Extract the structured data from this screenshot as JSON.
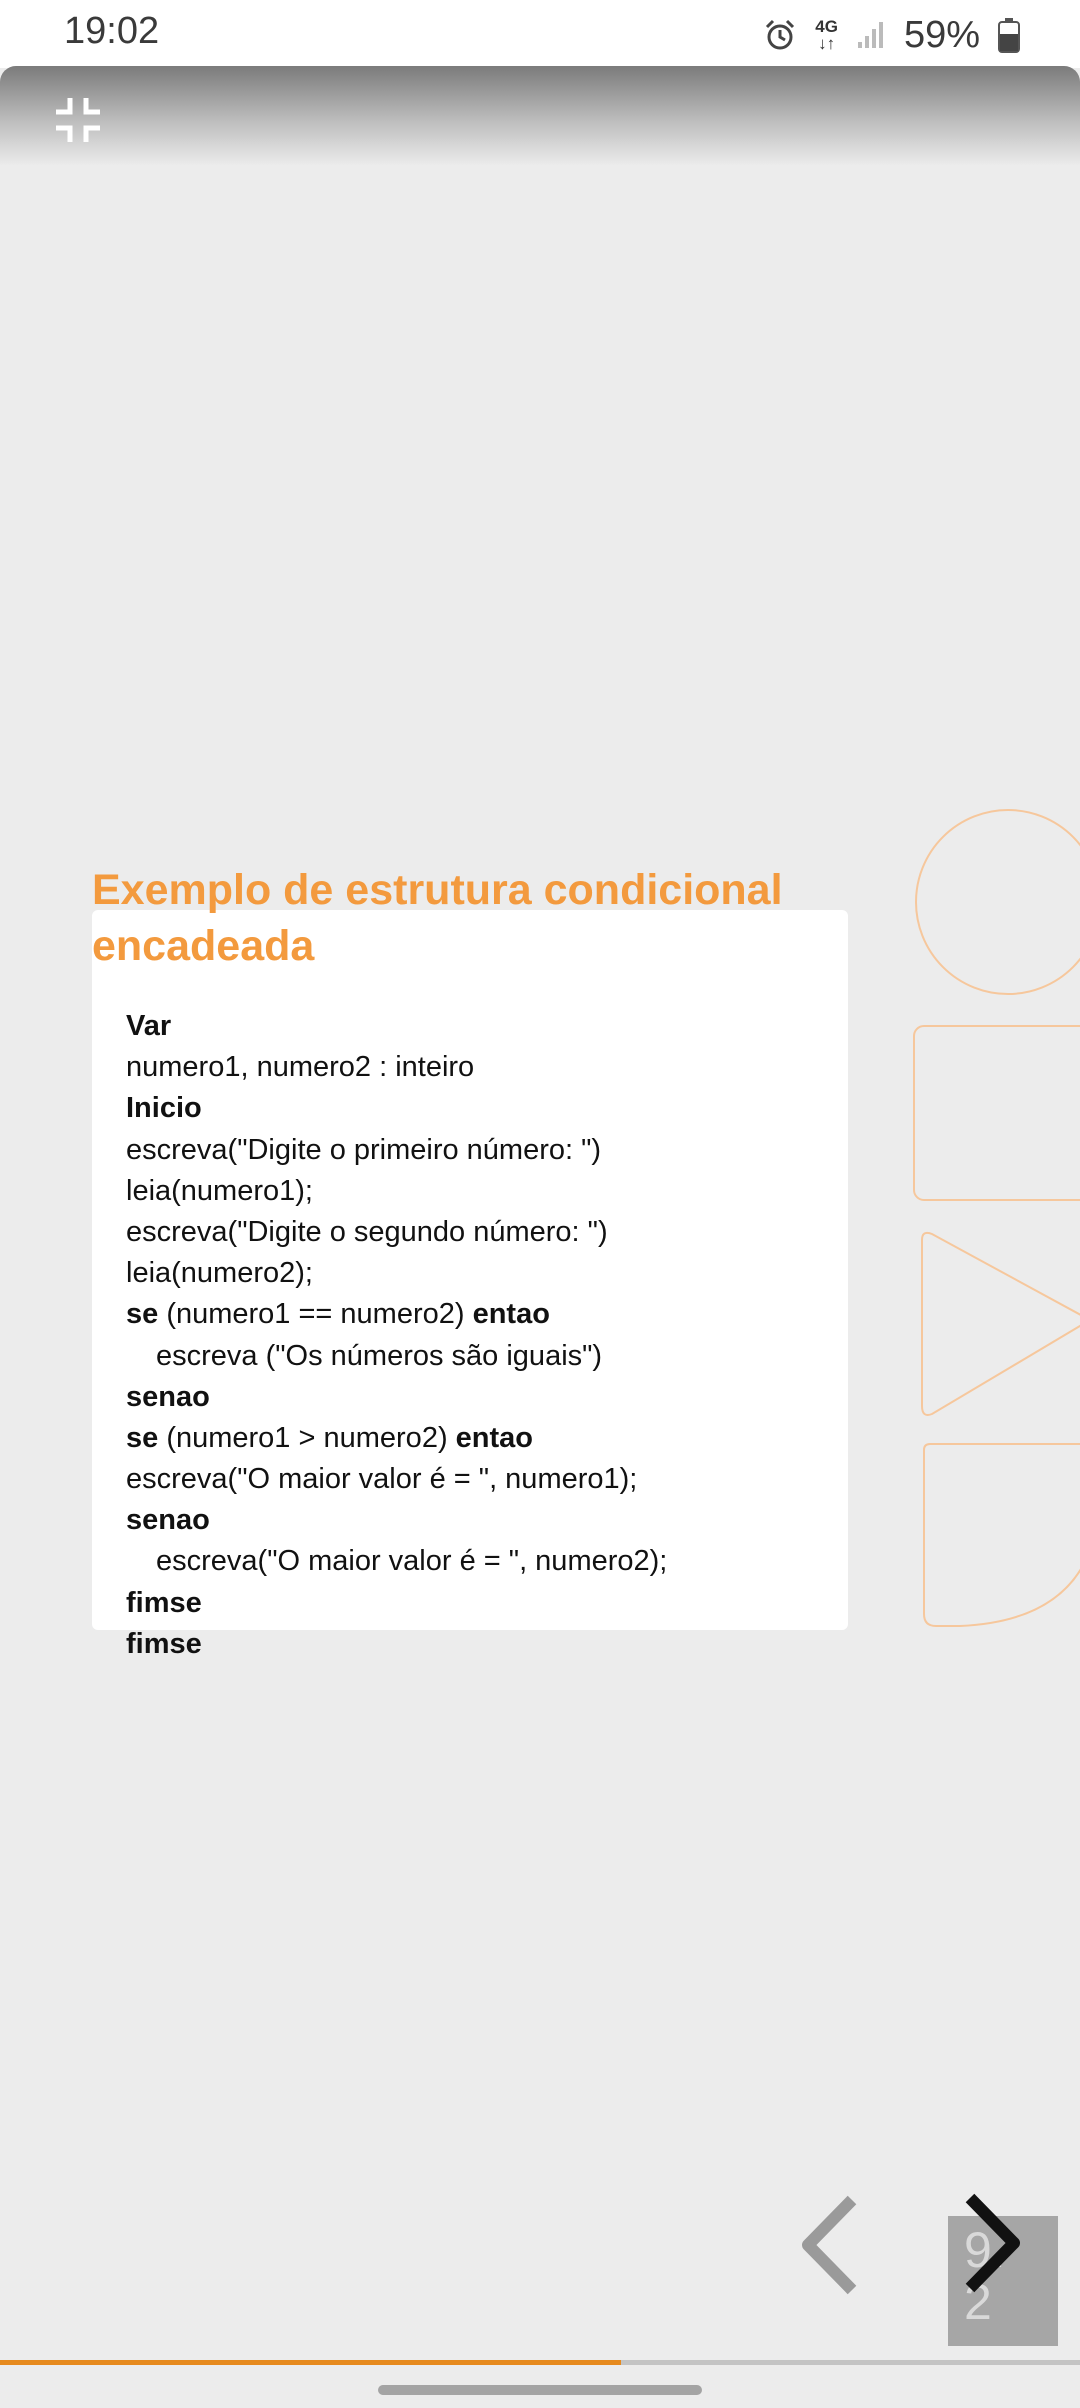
{
  "status_bar": {
    "time": "19:02",
    "network": "4G",
    "battery": "59%",
    "icons": [
      "alarm-icon",
      "4g-data-icon",
      "signal-icon",
      "battery-icon"
    ]
  },
  "toolbar": {
    "exit_fullscreen_icon": "exit-fullscreen-icon"
  },
  "slide": {
    "title": "Exemplo de estrutura condicional encadeada",
    "code_lines": [
      {
        "parts": [
          {
            "t": "Var",
            "b": true
          }
        ]
      },
      {
        "parts": [
          {
            "t": "numero1, numero2 : inteiro",
            "b": false
          }
        ]
      },
      {
        "parts": [
          {
            "t": "Inicio",
            "b": true
          }
        ]
      },
      {
        "parts": [
          {
            "t": "escreva(\"Digite o primeiro número: \")",
            "b": false
          }
        ]
      },
      {
        "parts": [
          {
            "t": "leia(numero1);",
            "b": false
          }
        ]
      },
      {
        "parts": [
          {
            "t": "escreva(\"Digite o segundo número: \")",
            "b": false
          }
        ]
      },
      {
        "parts": [
          {
            "t": "leia(numero2);",
            "b": false
          }
        ]
      },
      {
        "parts": [
          {
            "t": "se",
            "b": true
          },
          {
            "t": " (numero1 == numero2) ",
            "b": false
          },
          {
            "t": "entao",
            "b": true
          }
        ]
      },
      {
        "indent": true,
        "parts": [
          {
            "t": "escreva (\"Os números são iguais\")",
            "b": false
          }
        ]
      },
      {
        "parts": [
          {
            "t": "senao",
            "b": true
          }
        ]
      },
      {
        "parts": [
          {
            "t": "se",
            "b": true
          },
          {
            "t": " (numero1 > numero2) ",
            "b": false
          },
          {
            "t": "entao",
            "b": true
          }
        ]
      },
      {
        "parts": [
          {
            "t": "escreva(\"O maior valor é = \", numero1);",
            "b": false
          }
        ]
      },
      {
        "parts": [
          {
            "t": "senao",
            "b": true
          }
        ]
      },
      {
        "indent": true,
        "parts": [
          {
            "t": "escreva(\"O maior valor é = \", numero2);",
            "b": false
          }
        ]
      },
      {
        "parts": [
          {
            "t": "fimse",
            "b": true
          }
        ]
      },
      {
        "parts": [
          {
            "t": "fimse",
            "b": true
          }
        ]
      }
    ]
  },
  "navigation": {
    "prev_icon": "chevron-left-icon",
    "next_icon": "chevron-right-icon",
    "page_badge": "9.\n2",
    "progress": 0.575
  },
  "colors": {
    "accent": "#f39a3e",
    "progress": "#e68a1e",
    "background": "#ececec"
  }
}
